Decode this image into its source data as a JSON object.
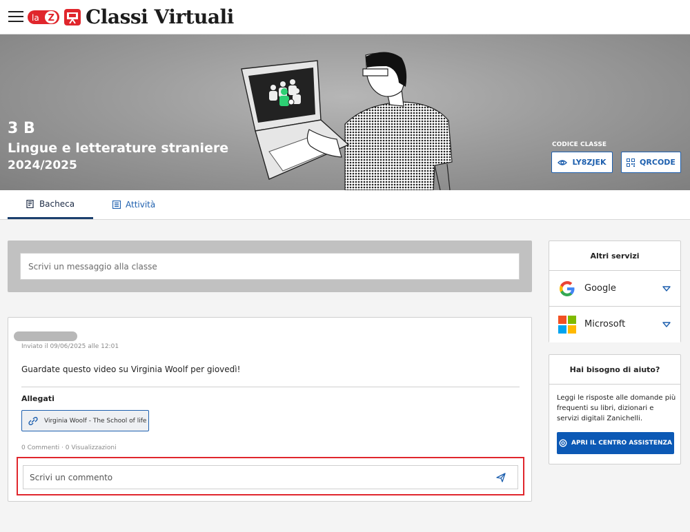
{
  "header": {
    "brand_badge": "la Z",
    "app_title": "Classi Virtuali"
  },
  "banner": {
    "class_name": "3 B",
    "subject": "Lingue e letterature straniere",
    "year": "2024/2025",
    "code_label": "CODICE CLASSE",
    "code_value": "LY8ZJEK",
    "qrcode_label": "QRCODE"
  },
  "tabs": [
    {
      "label": "Bacheca",
      "active": true,
      "icon": "board-icon"
    },
    {
      "label": "Attività",
      "active": false,
      "icon": "list-icon"
    }
  ],
  "compose": {
    "placeholder": "Scrivi un messaggio alla classe"
  },
  "post": {
    "date": "Inviato il 09/06/2025 alle 12:01",
    "text": "Guardate questo video su Virginia Woolf per giovedì!",
    "attachments_title": "Allegati",
    "attachment_label": "Virginia Woolf - The School of life",
    "stats": "0 Commenti · 0 Visualizzazioni",
    "comment_placeholder": "Scrivi un commento"
  },
  "sidebar": {
    "services_title": "Altri servizi",
    "services": [
      {
        "label": "Google",
        "icon": "google-icon"
      },
      {
        "label": "Microsoft",
        "icon": "microsoft-icon"
      }
    ],
    "help_title": "Hai bisogno di aiuto?",
    "help_text": "Leggi le risposte alle domande più frequenti su libri, dizionari e servizi digitali Zanichelli.",
    "help_button": "APRI IL CENTRO ASSISTENZA"
  },
  "colors": {
    "accent_blue": "#1d5fae",
    "help_button": "#0c59b5",
    "highlight_red": "#e0262c",
    "brand_red": "#e0262c"
  }
}
